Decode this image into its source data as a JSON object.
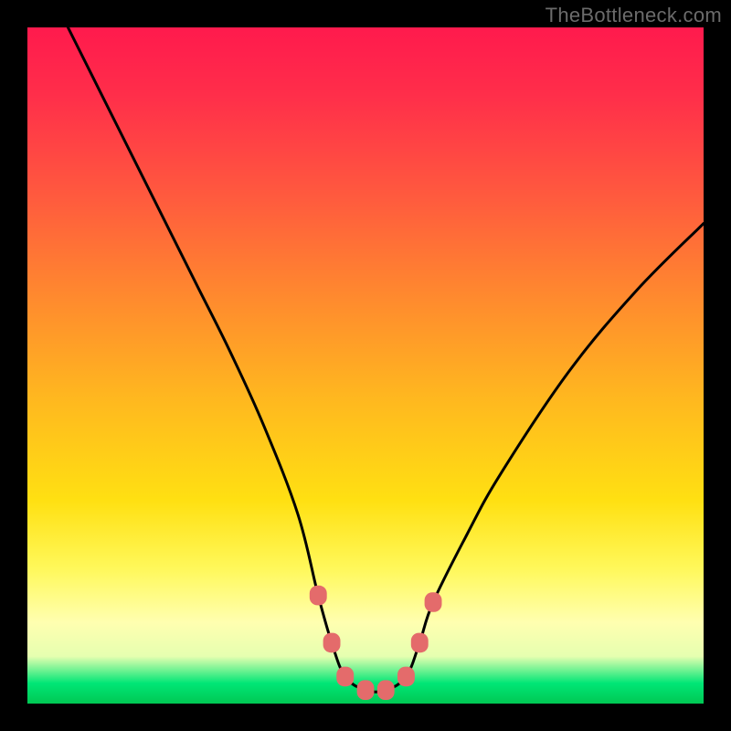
{
  "watermark": "TheBottleneck.com",
  "chart_data": {
    "type": "line",
    "title": "",
    "xlabel": "",
    "ylabel": "",
    "xlim": [
      0,
      100
    ],
    "ylim": [
      0,
      100
    ],
    "grid": false,
    "series": [
      {
        "name": "bottleneck-curve",
        "x": [
          6,
          10,
          15,
          20,
          25,
          30,
          35,
          40,
          43,
          45,
          47,
          50,
          53,
          56,
          58,
          60,
          65,
          70,
          80,
          90,
          100
        ],
        "values": [
          100,
          92,
          82,
          72,
          62,
          52,
          41,
          28,
          16,
          9,
          4,
          2,
          2,
          4,
          9,
          15,
          25,
          34,
          49,
          61,
          71
        ]
      }
    ],
    "markers": {
      "name": "highlight-points",
      "x": [
        43,
        45,
        47,
        50,
        53,
        56,
        58,
        60
      ],
      "values": [
        16,
        9,
        4,
        2,
        2,
        4,
        9,
        15
      ],
      "color": "#e46b6b",
      "radius_px": 9
    },
    "background_gradient": {
      "stops": [
        {
          "pos": 0.0,
          "color": "#ff1a4d"
        },
        {
          "pos": 0.4,
          "color": "#ff8a2e"
        },
        {
          "pos": 0.7,
          "color": "#ffe012"
        },
        {
          "pos": 0.88,
          "color": "#ffffb0"
        },
        {
          "pos": 0.97,
          "color": "#00e676"
        },
        {
          "pos": 1.0,
          "color": "#00c853"
        }
      ]
    }
  }
}
